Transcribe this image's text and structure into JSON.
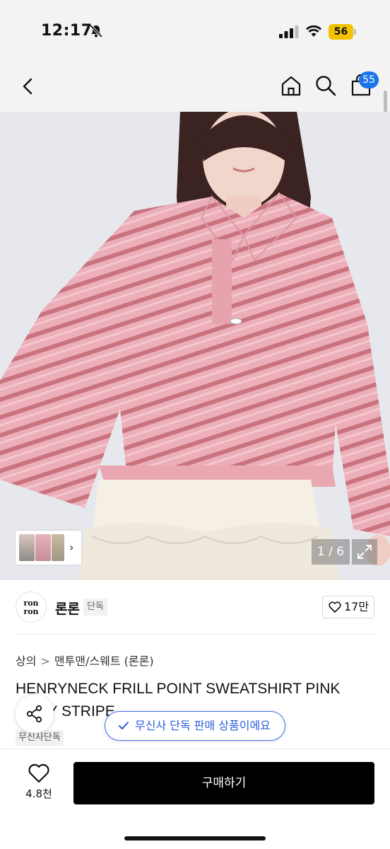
{
  "status_bar": {
    "time": "12:17",
    "battery": "56",
    "icons": [
      "bell-slash-icon",
      "cellular-signal-icon",
      "wifi-icon",
      "battery-icon"
    ]
  },
  "nav": {
    "icons": [
      "back-chevron-icon",
      "home-icon",
      "search-icon",
      "cart-icon"
    ],
    "cart_badge": "55"
  },
  "gallery": {
    "counter": "1 / 6",
    "current_image": 1,
    "total_images": 6,
    "icons": [
      "thumbnail-next-icon",
      "expand-icon"
    ]
  },
  "brand": {
    "logo_text": "ron ron",
    "name": "론론",
    "tag": "단독",
    "likes": "17만"
  },
  "breadcrumb": {
    "category": "상의",
    "separator": ">",
    "subcategory": "맨투맨/스웨트 (론론)"
  },
  "product": {
    "title": "HENRYNECK FRILL POINT SWEATSHIRT PINK GREY STRIPE",
    "exclusive_tag": "무신사단독"
  },
  "toast": {
    "text": "무신사 단독 판매 상품이에요"
  },
  "bottom_bar": {
    "wish_count": "4.8천",
    "buy_label": "구매하기"
  },
  "colors": {
    "accent_blue": "#1a73e8",
    "buy_button": "#000000",
    "battery": "#f2c200"
  }
}
